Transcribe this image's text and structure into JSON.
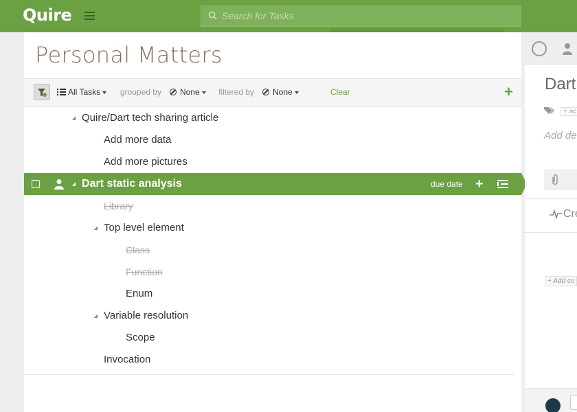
{
  "app": {
    "logo": "Quire"
  },
  "search": {
    "placeholder": "Search for Tasks"
  },
  "project": {
    "title": "Personal Matters"
  },
  "toolbar": {
    "view_label": "All Tasks",
    "grouped_by_label": "grouped by",
    "grouped_by_value": "None",
    "filtered_by_label": "filtered by",
    "filtered_by_value": "None",
    "clear_label": "Clear"
  },
  "tasks": [
    {
      "name": "Quire/Dart tech sharing article",
      "level": 0,
      "expandable": true,
      "done": false
    },
    {
      "name": "Add more data",
      "level": 1,
      "expandable": false,
      "done": false
    },
    {
      "name": "Add more pictures",
      "level": 1,
      "expandable": false,
      "done": false
    },
    {
      "name": "Dart static analysis",
      "level": 0,
      "expandable": true,
      "done": false,
      "selected": true,
      "due_label": "due date"
    },
    {
      "name": "Library",
      "level": 1,
      "expandable": false,
      "done": true
    },
    {
      "name": "Top level element",
      "level": 1,
      "expandable": true,
      "done": false
    },
    {
      "name": "Class",
      "level": 2,
      "expandable": false,
      "done": true
    },
    {
      "name": "Function",
      "level": 2,
      "expandable": false,
      "done": true
    },
    {
      "name": "Enum",
      "level": 2,
      "expandable": false,
      "done": false
    },
    {
      "name": "Variable resolution",
      "level": 1,
      "expandable": true,
      "done": false
    },
    {
      "name": "Scope",
      "level": 2,
      "expandable": false,
      "done": false
    },
    {
      "name": "Invocation",
      "level": 1,
      "expandable": false,
      "done": false
    }
  ],
  "detail": {
    "title": "Dart",
    "tag_placeholder": "+ ac",
    "description_placeholder": "Add de",
    "activity_label": "Cre",
    "comment_placeholder": "+ Add co"
  },
  "colors": {
    "brand": "#6ba043",
    "title": "#8a6d5a"
  }
}
